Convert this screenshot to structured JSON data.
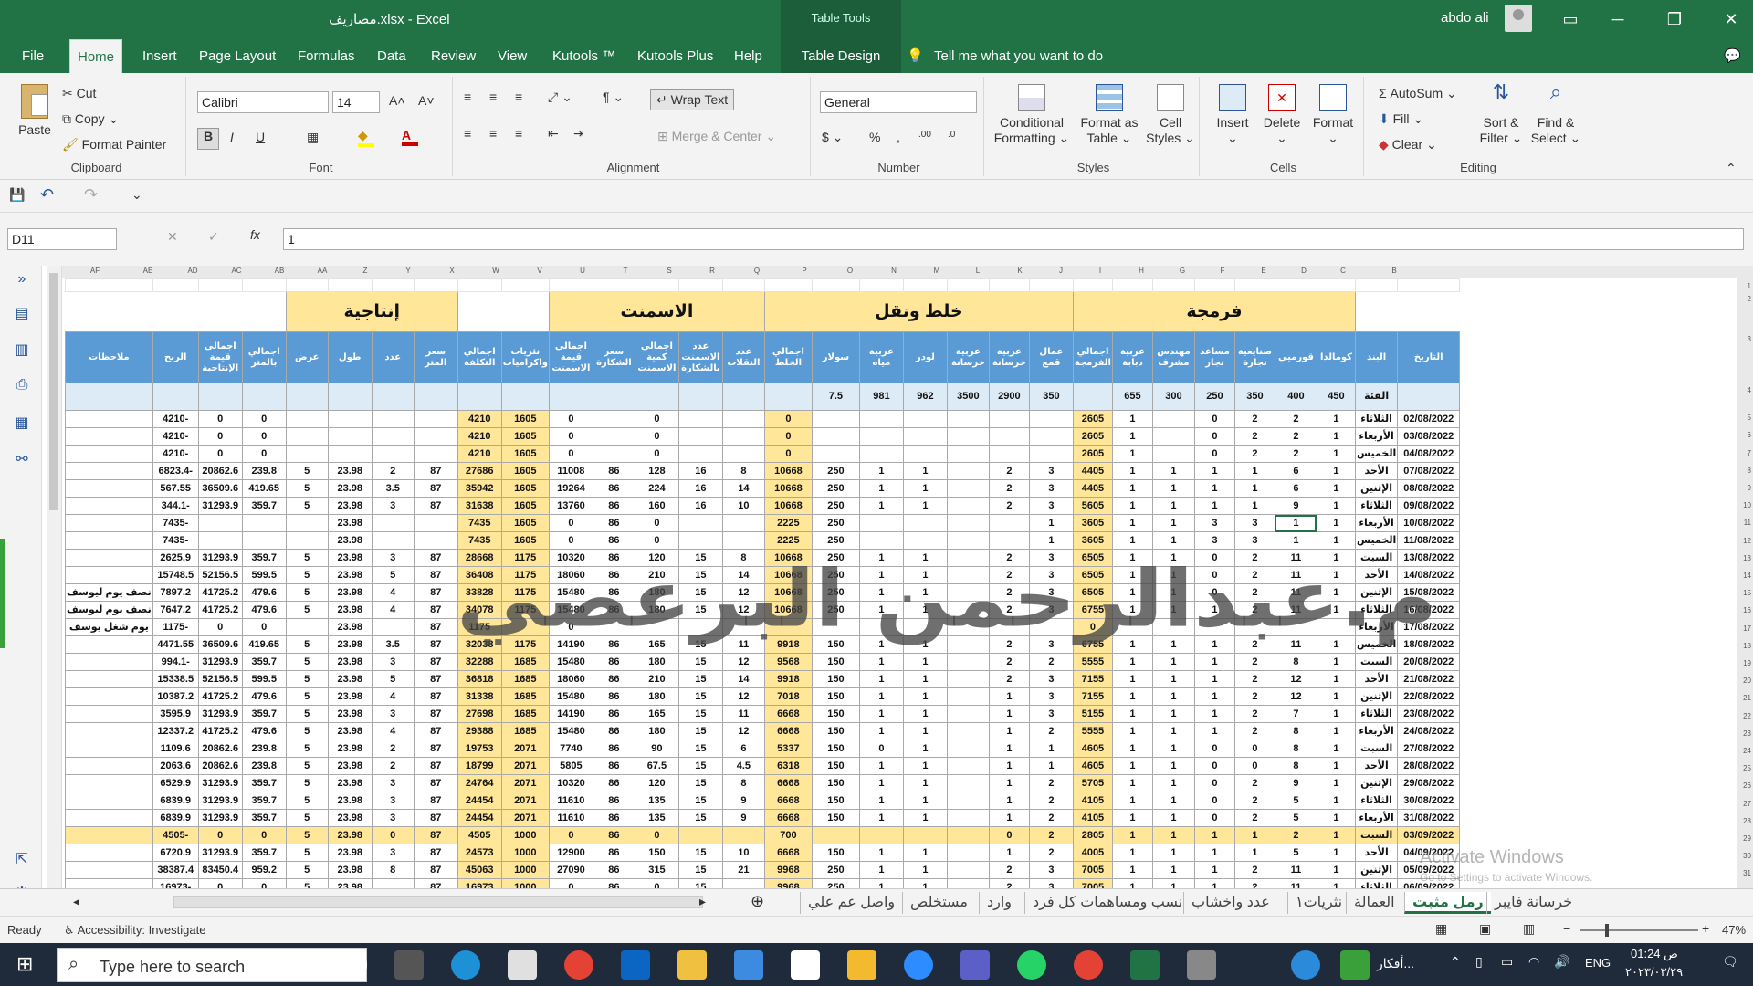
{
  "app": {
    "title": "مصاريف.xlsx - Excel",
    "table_tools": "Table Tools",
    "user": "abdo ali"
  },
  "tabs": [
    "File",
    "Home",
    "Insert",
    "Page Layout",
    "Formulas",
    "Data",
    "Review",
    "View",
    "Kutools ™",
    "Kutools Plus",
    "Help",
    "Table Design"
  ],
  "tell_me": "Tell me what you want to do",
  "ribbon": {
    "paste": "Paste",
    "cut": "Cut",
    "copy": "Copy",
    "format_painter": "Format Painter",
    "clipboard": "Clipboard",
    "font_name": "Calibri",
    "font_size": "14",
    "font": "Font",
    "wrap_text": "Wrap Text",
    "merge_center": "Merge & Center",
    "alignment": "Alignment",
    "number_format": "General",
    "number": "Number",
    "conditional": "Conditional",
    "formatting": "Formatting",
    "format_as": "Format as",
    "table": "Table",
    "cell": "Cell",
    "styles_btn": "Styles",
    "styles": "Styles",
    "insert": "Insert",
    "delete": "Delete",
    "format": "Format",
    "cells": "Cells",
    "autosum": "AutoSum",
    "fill": "Fill",
    "clear": "Clear",
    "sort_filter": "Sort &",
    "filter": "Filter",
    "find_select": "Find &",
    "select": "Select",
    "editing": "Editing"
  },
  "formula_bar": {
    "name_box": "D11",
    "fx": "fx",
    "value": "1"
  },
  "columns": [
    "AF",
    "AE",
    "AD",
    "AC",
    "AB",
    "AA",
    "Z",
    "Y",
    "X",
    "W",
    "V",
    "U",
    "T",
    "S",
    "R",
    "Q",
    "P",
    "O",
    "N",
    "M",
    "L",
    "K",
    "J",
    "I",
    "H",
    "G",
    "F",
    "E",
    "D",
    "C",
    "B",
    "A"
  ],
  "groups": {
    "g1": "إنتاجية",
    "g2": "الاسمنت",
    "g3": "خلط ونقل",
    "g4": "فرمجة"
  },
  "headers": [
    "التاريخ",
    "البند",
    "كومالدا",
    "قورميي",
    "صنايعية نجارة",
    "مساعد نجار",
    "مهندس مشرف",
    "عربية دبابة",
    "اجمالي الفرمجة",
    "عمال قمع",
    "عربية خرسانة",
    "عربية خرسانة",
    "لودر",
    "عربية مياه",
    "سولار",
    "اجمالي الخلط",
    "عدد النقلات",
    "عدد الاسمنت بالشكارة",
    "اجمالي كمية الاسمنت",
    "سعر الشكارة",
    "اجمالي قيمة الاسمنت",
    "نثريات واكراميات",
    "اجمالي التكلفة",
    "سعر المتر",
    "عدد",
    "طول",
    "عرض",
    "اجمالي بالمتر",
    "اجمالي قيمة الإنتاجية",
    "الربح",
    "ملاحظات"
  ],
  "prices": [
    "",
    "الفئة",
    "450",
    "400",
    "350",
    "250",
    "300",
    "655",
    "",
    "350",
    "2900",
    "3500",
    "962",
    "981",
    "7.5",
    "",
    "",
    "",
    "",
    "",
    "",
    "",
    "",
    "",
    "",
    "",
    "",
    "",
    "",
    "",
    ""
  ],
  "rows": [
    [
      "02/08/2022",
      "الثلاثاء",
      "1",
      "2",
      "2",
      "0",
      "",
      "1",
      "2605",
      "",
      "",
      "",
      "",
      "",
      "",
      "0",
      "",
      "",
      "0",
      "",
      "0",
      "1605",
      "4210",
      "",
      "",
      "",
      "",
      "0",
      "0",
      "-4210",
      ""
    ],
    [
      "03/08/2022",
      "الأربعاء",
      "1",
      "2",
      "2",
      "0",
      "",
      "1",
      "2605",
      "",
      "",
      "",
      "",
      "",
      "",
      "0",
      "",
      "",
      "0",
      "",
      "0",
      "1605",
      "4210",
      "",
      "",
      "",
      "",
      "0",
      "0",
      "-4210",
      ""
    ],
    [
      "04/08/2022",
      "الخميس",
      "1",
      "2",
      "2",
      "0",
      "",
      "1",
      "2605",
      "",
      "",
      "",
      "",
      "",
      "",
      "0",
      "",
      "",
      "0",
      "",
      "0",
      "1605",
      "4210",
      "",
      "",
      "",
      "",
      "0",
      "0",
      "-4210",
      ""
    ],
    [
      "07/08/2022",
      "الأحد",
      "1",
      "6",
      "1",
      "1",
      "1",
      "1",
      "4405",
      "3",
      "2",
      "",
      "1",
      "1",
      "250",
      "10668",
      "8",
      "16",
      "128",
      "86",
      "11008",
      "1605",
      "27686",
      "87",
      "2",
      "23.98",
      "5",
      "239.8",
      "20862.6",
      "-6823.4",
      ""
    ],
    [
      "08/08/2022",
      "الإثنين",
      "1",
      "6",
      "1",
      "1",
      "1",
      "1",
      "4405",
      "3",
      "2",
      "",
      "1",
      "1",
      "250",
      "10668",
      "14",
      "16",
      "224",
      "86",
      "19264",
      "1605",
      "35942",
      "87",
      "3.5",
      "23.98",
      "5",
      "419.65",
      "36509.6",
      "567.55",
      ""
    ],
    [
      "09/08/2022",
      "الثلاثاء",
      "1",
      "9",
      "1",
      "1",
      "1",
      "1",
      "5605",
      "3",
      "2",
      "",
      "1",
      "1",
      "250",
      "10668",
      "10",
      "16",
      "160",
      "86",
      "13760",
      "1605",
      "31638",
      "87",
      "3",
      "23.98",
      "5",
      "359.7",
      "31293.9",
      "-344.1",
      ""
    ],
    [
      "10/08/2022",
      "الأربعاء",
      "1",
      "1",
      "3",
      "3",
      "1",
      "1",
      "3605",
      "1",
      "",
      "",
      "",
      "",
      "250",
      "2225",
      "",
      "",
      "0",
      "86",
      "0",
      "1605",
      "7435",
      "",
      "",
      "23.98",
      "",
      "",
      "",
      "-7435",
      ""
    ],
    [
      "11/08/2022",
      "الخميس",
      "1",
      "1",
      "3",
      "3",
      "1",
      "1",
      "3605",
      "1",
      "",
      "",
      "",
      "",
      "250",
      "2225",
      "",
      "",
      "0",
      "86",
      "0",
      "1605",
      "7435",
      "",
      "",
      "23.98",
      "",
      "",
      "",
      "-7435",
      ""
    ],
    [
      "13/08/2022",
      "السبت",
      "1",
      "11",
      "2",
      "0",
      "1",
      "1",
      "6505",
      "3",
      "2",
      "",
      "1",
      "1",
      "250",
      "10668",
      "8",
      "15",
      "120",
      "86",
      "10320",
      "1175",
      "28668",
      "87",
      "3",
      "23.98",
      "5",
      "359.7",
      "31293.9",
      "2625.9",
      ""
    ],
    [
      "14/08/2022",
      "الأحد",
      "1",
      "11",
      "2",
      "0",
      "1",
      "1",
      "6505",
      "3",
      "2",
      "",
      "1",
      "1",
      "250",
      "10668",
      "14",
      "15",
      "210",
      "86",
      "18060",
      "1175",
      "36408",
      "87",
      "5",
      "23.98",
      "5",
      "599.5",
      "52156.5",
      "15748.5",
      ""
    ],
    [
      "15/08/2022",
      "الإثنين",
      "1",
      "11",
      "2",
      "0",
      "1",
      "1",
      "6505",
      "3",
      "2",
      "",
      "1",
      "1",
      "250",
      "10668",
      "12",
      "15",
      "180",
      "86",
      "15480",
      "1175",
      "33828",
      "87",
      "4",
      "23.98",
      "5",
      "479.6",
      "41725.2",
      "7897.2",
      "نصف يوم ليوسف"
    ],
    [
      "16/08/2022",
      "الثلاثاء",
      "1",
      "11",
      "2",
      "1",
      "1",
      "1",
      "6755",
      "3",
      "2",
      "",
      "1",
      "1",
      "250",
      "10668",
      "12",
      "15",
      "180",
      "86",
      "15480",
      "1175",
      "34078",
      "87",
      "4",
      "23.98",
      "5",
      "479.6",
      "41725.2",
      "7647.2",
      "نصف يوم ليوسف"
    ],
    [
      "17/08/2022",
      "الأربعاء",
      "",
      "",
      "",
      "",
      "",
      "",
      "0",
      "",
      "",
      "",
      "",
      "",
      "",
      "",
      "",
      "",
      "",
      "",
      "0",
      "",
      "1175",
      "87",
      "",
      "23.98",
      "",
      "0",
      "0",
      "-1175",
      "يوم شغل يوسف"
    ],
    [
      "18/08/2022",
      "الخميس",
      "1",
      "11",
      "2",
      "1",
      "1",
      "1",
      "6755",
      "3",
      "2",
      "",
      "1",
      "1",
      "150",
      "9918",
      "11",
      "15",
      "165",
      "86",
      "14190",
      "1175",
      "32038",
      "87",
      "3.5",
      "23.98",
      "5",
      "419.65",
      "36509.6",
      "4471.55",
      ""
    ],
    [
      "20/08/2022",
      "السبت",
      "1",
      "8",
      "2",
      "1",
      "1",
      "1",
      "5555",
      "2",
      "2",
      "",
      "1",
      "1",
      "150",
      "9568",
      "12",
      "15",
      "180",
      "86",
      "15480",
      "1685",
      "32288",
      "87",
      "3",
      "23.98",
      "5",
      "359.7",
      "31293.9",
      "-994.1",
      ""
    ],
    [
      "21/08/2022",
      "الأحد",
      "1",
      "12",
      "2",
      "1",
      "1",
      "1",
      "7155",
      "3",
      "2",
      "",
      "1",
      "1",
      "150",
      "9918",
      "14",
      "15",
      "210",
      "86",
      "18060",
      "1685",
      "36818",
      "87",
      "5",
      "23.98",
      "5",
      "599.5",
      "52156.5",
      "15338.5",
      ""
    ],
    [
      "22/08/2022",
      "الإثنين",
      "1",
      "12",
      "2",
      "1",
      "1",
      "1",
      "7155",
      "3",
      "1",
      "",
      "1",
      "1",
      "150",
      "7018",
      "12",
      "15",
      "180",
      "86",
      "15480",
      "1685",
      "31338",
      "87",
      "4",
      "23.98",
      "5",
      "479.6",
      "41725.2",
      "10387.2",
      ""
    ],
    [
      "23/08/2022",
      "الثلاثاء",
      "1",
      "7",
      "2",
      "1",
      "1",
      "1",
      "5155",
      "3",
      "1",
      "",
      "1",
      "1",
      "150",
      "6668",
      "11",
      "15",
      "165",
      "86",
      "14190",
      "1685",
      "27698",
      "87",
      "3",
      "23.98",
      "5",
      "359.7",
      "31293.9",
      "3595.9",
      ""
    ],
    [
      "24/08/2022",
      "الأربعاء",
      "1",
      "8",
      "2",
      "1",
      "1",
      "1",
      "5555",
      "2",
      "1",
      "",
      "1",
      "1",
      "150",
      "6668",
      "12",
      "15",
      "180",
      "86",
      "15480",
      "1685",
      "29388",
      "87",
      "4",
      "23.98",
      "5",
      "479.6",
      "41725.2",
      "12337.2",
      ""
    ],
    [
      "27/08/2022",
      "السبت",
      "1",
      "8",
      "0",
      "0",
      "1",
      "1",
      "4605",
      "1",
      "1",
      "",
      "1",
      "0",
      "150",
      "5337",
      "6",
      "15",
      "90",
      "86",
      "7740",
      "2071",
      "19753",
      "87",
      "2",
      "23.98",
      "5",
      "239.8",
      "20862.6",
      "1109.6",
      ""
    ],
    [
      "28/08/2022",
      "الأحد",
      "1",
      "8",
      "0",
      "0",
      "1",
      "1",
      "4605",
      "1",
      "1",
      "",
      "1",
      "1",
      "150",
      "6318",
      "4.5",
      "15",
      "67.5",
      "86",
      "5805",
      "2071",
      "18799",
      "87",
      "2",
      "23.98",
      "5",
      "239.8",
      "20862.6",
      "2063.6",
      ""
    ],
    [
      "29/08/2022",
      "الإثنين",
      "1",
      "9",
      "2",
      "0",
      "1",
      "1",
      "5705",
      "2",
      "1",
      "",
      "1",
      "1",
      "150",
      "6668",
      "8",
      "15",
      "120",
      "86",
      "10320",
      "2071",
      "24764",
      "87",
      "3",
      "23.98",
      "5",
      "359.7",
      "31293.9",
      "6529.9",
      ""
    ],
    [
      "30/08/2022",
      "الثلاثاء",
      "1",
      "5",
      "2",
      "0",
      "1",
      "1",
      "4105",
      "2",
      "1",
      "",
      "1",
      "1",
      "150",
      "6668",
      "9",
      "15",
      "135",
      "86",
      "11610",
      "2071",
      "24454",
      "87",
      "3",
      "23.98",
      "5",
      "359.7",
      "31293.9",
      "6839.9",
      ""
    ],
    [
      "31/08/2022",
      "الأربعاء",
      "1",
      "5",
      "2",
      "0",
      "1",
      "1",
      "4105",
      "2",
      "1",
      "",
      "1",
      "1",
      "150",
      "6668",
      "9",
      "15",
      "135",
      "86",
      "11610",
      "2071",
      "24454",
      "87",
      "3",
      "23.98",
      "5",
      "359.7",
      "31293.9",
      "6839.9",
      ""
    ],
    [
      "03/09/2022",
      "السبت",
      "1",
      "2",
      "1",
      "1",
      "1",
      "1",
      "2805",
      "2",
      "0",
      "",
      "",
      "",
      "",
      "700",
      "",
      "",
      "0",
      "86",
      "0",
      "1000",
      "4505",
      "87",
      "0",
      "23.98",
      "5",
      "0",
      "0",
      "-4505",
      ""
    ],
    [
      "04/09/2022",
      "الأحد",
      "1",
      "5",
      "1",
      "1",
      "1",
      "1",
      "4005",
      "2",
      "1",
      "",
      "1",
      "1",
      "150",
      "6668",
      "10",
      "15",
      "150",
      "86",
      "12900",
      "1000",
      "24573",
      "87",
      "3",
      "23.98",
      "5",
      "359.7",
      "31293.9",
      "6720.9",
      ""
    ],
    [
      "05/09/2022",
      "الإثنين",
      "1",
      "11",
      "2",
      "1",
      "1",
      "1",
      "7005",
      "3",
      "2",
      "",
      "1",
      "1",
      "250",
      "9968",
      "21",
      "15",
      "315",
      "86",
      "27090",
      "1000",
      "45063",
      "87",
      "8",
      "23.98",
      "5",
      "959.2",
      "83450.4",
      "38387.4",
      ""
    ],
    [
      "06/09/2022",
      "الثلاثاء",
      "1",
      "11",
      "2",
      "1",
      "1",
      "1",
      "7005",
      "3",
      "2",
      "",
      "1",
      "1",
      "250",
      "9968",
      "",
      "15",
      "0",
      "86",
      "0",
      "1000",
      "16973",
      "87",
      "",
      "23.98",
      "5",
      "0",
      "0",
      "-16973",
      ""
    ]
  ],
  "watermark": "م.عبدالرحمن البرعصي",
  "activation": {
    "line1": "Activate Windows",
    "line2": "Go to Settings to activate Windows."
  },
  "sheet_tabs": [
    "خرسانة فايبر",
    "رمل مثبت",
    "العمالة",
    "نثريات١",
    "عدد واخشاب",
    "نسب ومساهمات كل فرد",
    "وارد",
    "مستخلص",
    "واصل عم علي"
  ],
  "status": {
    "ready": "Ready",
    "accessibility": "Accessibility: Investigate",
    "zoom": "47%"
  },
  "taskbar": {
    "search_placeholder": "Type here to search",
    "time": "01:24 ص",
    "date": "٢٠٢٣/٠٣/٢٩",
    "lang": "ENG",
    "news": "أفكار..."
  }
}
